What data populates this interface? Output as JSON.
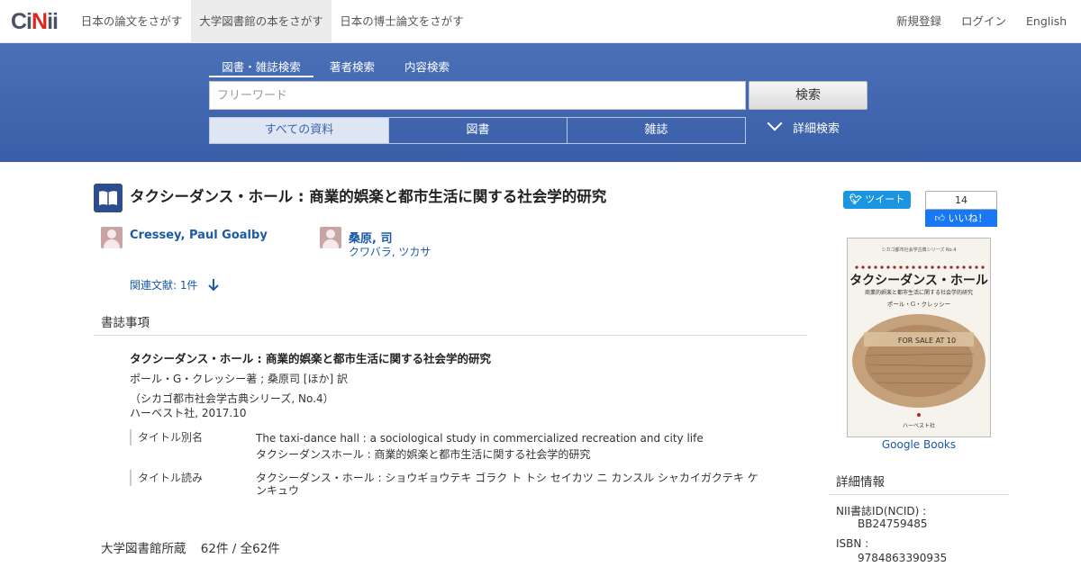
{
  "header": {
    "logo": "CiNii",
    "nav": [
      "日本の論文をさがす",
      "大学図書館の本をさがす",
      "日本の博士論文をさがす"
    ],
    "right": [
      "新規登録",
      "ログイン",
      "English"
    ]
  },
  "search": {
    "tabs": [
      "図書・雑誌検索",
      "著者検索",
      "内容検索"
    ],
    "placeholder": "フリーワード",
    "button": "検索",
    "filters": [
      "すべての資料",
      "図書",
      "雑誌"
    ],
    "advanced": "詳細検索"
  },
  "record": {
    "title": "タクシーダンス・ホール : 商業的娯楽と都市生活に関する社会学的研究",
    "authors": [
      {
        "name": "Cressey, Paul Goalby",
        "kana": ""
      },
      {
        "name": "桑原, 司",
        "kana": "クワバラ, ツカサ"
      }
    ],
    "related": "関連文献: 1件"
  },
  "biblio": {
    "heading": "書誌事項",
    "title": "タクシーダンス・ホール : 商業的娯楽と都市生活に関する社会学的研究",
    "responsibility": "ポール・G・クレッシー著 ; 桑原司 [ほか] 訳",
    "series": "（シカゴ都市社会学古典シリーズ, No.4）",
    "publisher": "ハーベスト社, 2017.10",
    "alt_title_label": "タイトル別名",
    "alt_titles": [
      "The taxi-dance hall : a sociological study in commercialized recreation and city life",
      "タクシーダンスホール : 商業的娯楽と都市生活に関する社会学的研究"
    ],
    "reading_label": "タイトル読み",
    "reading_line1": "タクシーダンス・ホール : ショウギョウテキ ゴラク ト トシ セイカツ ニ カンスル シャカイガクテキ ケ",
    "reading_line2": "ンキュウ"
  },
  "holdings": {
    "heading": "大学図書館所蔵",
    "count": "62件 / 全62件"
  },
  "side": {
    "tweet": "ツイート",
    "like_count": "14",
    "like": "いいね！",
    "google_books": "Google Books",
    "cover": {
      "series": "シカゴ都市社会学古典シリーズ No.4",
      "title": "タクシーダンス・ホール",
      "subtitle": "商業的娯楽と都市生活に関する社会学的研究",
      "author": "ポール・G・クレッシー",
      "sign": "FOR SALE AT 10",
      "publisher": "ハーベスト社"
    },
    "detail_heading": "詳細情報",
    "details": [
      {
        "label": "NII書誌ID(NCID) :",
        "value": "BB24759485"
      },
      {
        "label": "ISBN :",
        "value": "9784863390935"
      }
    ]
  },
  "colors": {
    "band": "#3e64ad",
    "link": "#1a5aa8",
    "tweet": "#1b95e0",
    "fb": "#1877f2",
    "logo_dot": "#e0261c"
  }
}
